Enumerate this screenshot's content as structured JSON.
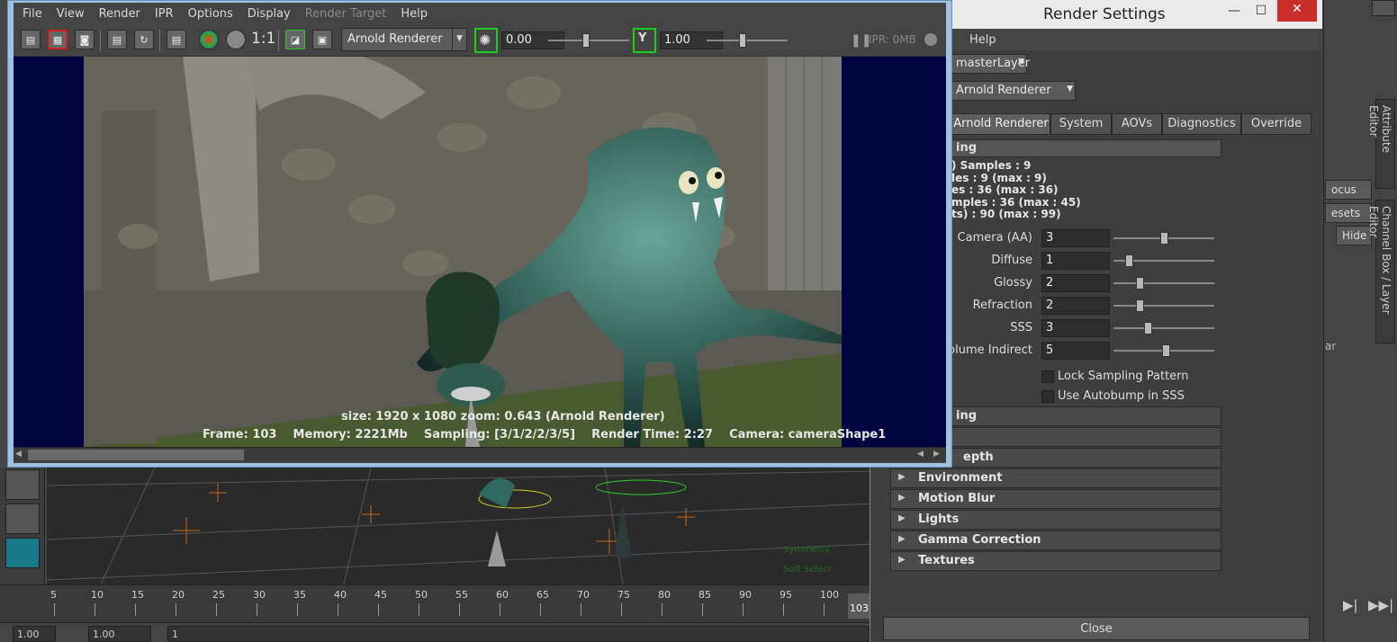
{
  "render_view": {
    "menu": [
      "File",
      "View",
      "Render",
      "IPR",
      "Options",
      "Display",
      "Render Target",
      "Help"
    ],
    "disabled_menu": "Render Target",
    "toolbar": {
      "one_to_one": "1:1",
      "renderer": "Arnold Renderer",
      "exposure": "0.00",
      "gamma": "1.00",
      "gamma_icon_letter": "Y",
      "ipr_label": "IPR: 0MB"
    },
    "status_line1": "size: 1920 x 1080 zoom: 0.643    (Arnold Renderer)",
    "status_line2": "Frame: 103    Memory: 2221Mb    Sampling: [3/1/2/2/3/5]    Render Time: 2:27    Camera: cameraShape1"
  },
  "render_settings": {
    "title": "Render Settings",
    "help": "Help",
    "render_layer": "masterLayer",
    "renderer": "Arnold Renderer",
    "tabs": [
      "Arnold Renderer",
      "System",
      "AOVs",
      "Diagnostics",
      "Override"
    ],
    "active_tab": "Arnold Renderer",
    "sampling_header": "ing",
    "sample_lines": [
      ") Samples : 9",
      "les : 9 (max : 9)",
      "es : 36 (max : 36)",
      "mples : 36 (max : 45)",
      "ts) : 90 (max : 99)"
    ],
    "rows": [
      {
        "label": "Camera (AA)",
        "value": "3",
        "fraction": 0.46
      },
      {
        "label": "Diffuse",
        "value": "1",
        "fraction": 0.12
      },
      {
        "label": "Glossy",
        "value": "2",
        "fraction": 0.22
      },
      {
        "label": "Refraction",
        "value": "2",
        "fraction": 0.22
      },
      {
        "label": "SSS",
        "value": "3",
        "fraction": 0.3
      },
      {
        "label": "Volume Indirect",
        "value": "5",
        "fraction": 0.48
      }
    ],
    "lock_sampling": "Lock Sampling Pattern",
    "autobump": "Use Autobump in SSS",
    "partial_sections": [
      "ing",
      "",
      "epth"
    ],
    "sections": [
      "Environment",
      "Motion Blur",
      "Lights",
      "Gamma Correction",
      "Textures"
    ],
    "close": "Close"
  },
  "timeline": {
    "ticks": [
      "5",
      "10",
      "15",
      "20",
      "25",
      "30",
      "35",
      "40",
      "45",
      "50",
      "55",
      "60",
      "65",
      "70",
      "75",
      "80",
      "85",
      "90",
      "95",
      "100"
    ],
    "current_frame": "103",
    "range_start": "1.00",
    "range_start2": "1.00",
    "range_marker": "1"
  },
  "side_panel": {
    "buttons": [
      "ocus",
      "esets",
      "Hide"
    ],
    "vertical_tabs": [
      "Attribute Editor",
      "Channel Box / Layer Editor"
    ],
    "layer_label": "ar"
  },
  "viewport": {
    "symmetry": "Symmetry",
    "soft_select": "Soft Select"
  },
  "colors": {
    "maya_bg": "#444444",
    "render_canvas": "#01053f",
    "ipr_green": "#1dcc1d",
    "creature": "#2f6a60"
  }
}
